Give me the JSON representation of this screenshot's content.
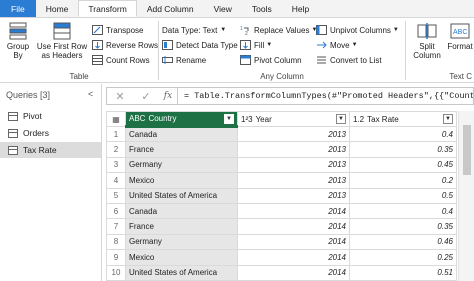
{
  "tabs": [
    {
      "label": "File",
      "kind": "file"
    },
    {
      "label": "Home",
      "kind": ""
    },
    {
      "label": "Transform",
      "kind": "active"
    },
    {
      "label": "Add Column",
      "kind": ""
    },
    {
      "label": "View",
      "kind": ""
    },
    {
      "label": "Tools",
      "kind": ""
    },
    {
      "label": "Help",
      "kind": ""
    }
  ],
  "ribbon": {
    "table_group": {
      "label": "Table",
      "group_by": "Group\nBy",
      "use_first_row": "Use First Row\nas Headers",
      "transpose": "Transpose",
      "reverse_rows": "Reverse Rows",
      "count_rows": "Count Rows"
    },
    "any_column_group": {
      "label": "Any Column",
      "data_type": "Data Type: Text",
      "detect_data_type": "Detect Data Type",
      "rename": "Rename",
      "replace_values": "Replace Values",
      "fill": "Fill",
      "pivot_column": "Pivot Column",
      "unpivot_columns": "Unpivot Columns",
      "move": "Move",
      "convert_to_list": "Convert to List"
    },
    "text_group": {
      "label": "Text C",
      "split_column": "Split\nColumn",
      "format": "Format"
    }
  },
  "queries": {
    "header": "Queries [3]",
    "collapse": "<",
    "items": [
      "Pivot",
      "Orders",
      "Tax Rate"
    ],
    "selected": "Tax Rate"
  },
  "formula": {
    "cancel": "✕",
    "confirm": "✓",
    "fx": "fx",
    "text": "= Table.TransformColumnTypes(#\"Promoted Headers\",{{\"Country\","
  },
  "grid": {
    "columns": [
      {
        "type_icon": "ABC",
        "name": "Country"
      },
      {
        "type_icon": "1²3",
        "name": "Year"
      },
      {
        "type_icon": "1.2",
        "name": "Tax Rate"
      }
    ],
    "rows": [
      {
        "n": "1",
        "country": "Canada",
        "year": "2013",
        "rate": "0.4"
      },
      {
        "n": "2",
        "country": "France",
        "year": "2013",
        "rate": "0.35"
      },
      {
        "n": "3",
        "country": "Germany",
        "year": "2013",
        "rate": "0.45"
      },
      {
        "n": "4",
        "country": "Mexico",
        "year": "2013",
        "rate": "0.2"
      },
      {
        "n": "5",
        "country": "United States of America",
        "year": "2013",
        "rate": "0.5"
      },
      {
        "n": "6",
        "country": "Canada",
        "year": "2014",
        "rate": "0.4"
      },
      {
        "n": "7",
        "country": "France",
        "year": "2014",
        "rate": "0.35"
      },
      {
        "n": "8",
        "country": "Germany",
        "year": "2014",
        "rate": "0.46"
      },
      {
        "n": "9",
        "country": "Mexico",
        "year": "2014",
        "rate": "0.25"
      },
      {
        "n": "10",
        "country": "United States of America",
        "year": "2014",
        "rate": "0.51"
      }
    ]
  },
  "colors": {
    "file_tab": "#2b7cd3",
    "selected_column": "#1e7145"
  }
}
